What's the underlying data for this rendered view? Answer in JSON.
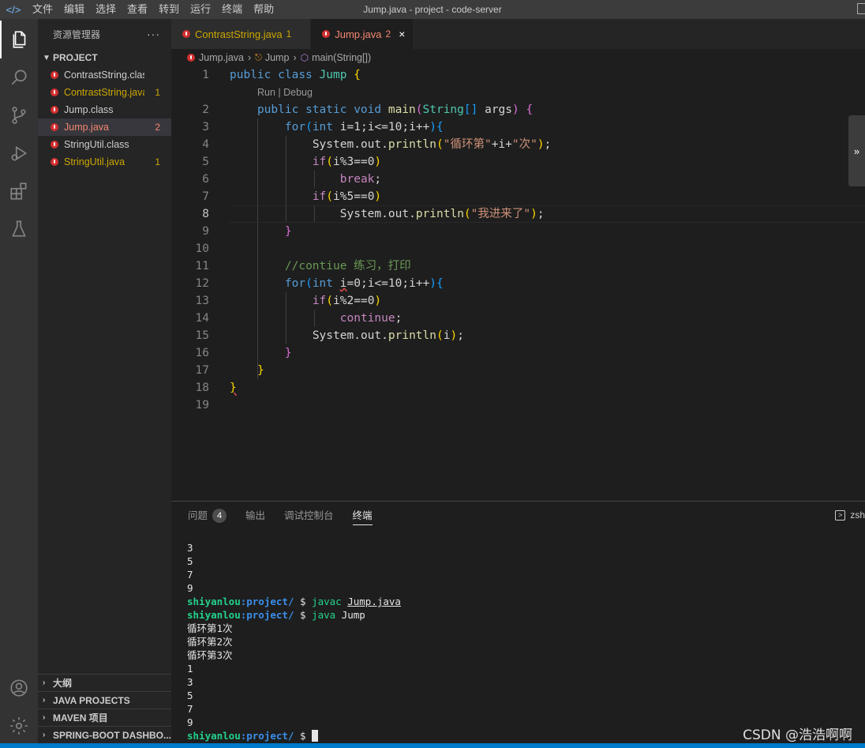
{
  "titlebar": {
    "menu": [
      "文件",
      "编辑",
      "选择",
      "查看",
      "转到",
      "运行",
      "终端",
      "帮助"
    ],
    "title": "Jump.java - project - code-server"
  },
  "activity": [
    "explorer-icon",
    "search-icon",
    "source-control-icon",
    "run-debug-icon",
    "extensions-icon",
    "testing-icon",
    "account-icon",
    "settings-gear-icon"
  ],
  "sidebar": {
    "header": "资源管理器",
    "more": "···",
    "project_title": "PROJECT",
    "files": [
      {
        "name": "ContrastString.class",
        "badge": "",
        "status": "normal"
      },
      {
        "name": "ContrastString.java",
        "badge": "1",
        "status": "warning"
      },
      {
        "name": "Jump.class",
        "badge": "",
        "status": "normal"
      },
      {
        "name": "Jump.java",
        "badge": "2",
        "status": "error"
      },
      {
        "name": "StringUtil.class",
        "badge": "",
        "status": "normal"
      },
      {
        "name": "StringUtil.java",
        "badge": "1",
        "status": "warning"
      }
    ],
    "bottom_sections": [
      "大纲",
      "JAVA PROJECTS",
      "MAVEN 项目",
      "SPRING-BOOT DASHBO..."
    ]
  },
  "tabs": [
    {
      "name": "ContrastString.java",
      "badge": "1",
      "active": false
    },
    {
      "name": "Jump.java",
      "badge": "2",
      "active": true,
      "close": "×"
    }
  ],
  "breadcrumb": [
    "Jump.java",
    "Jump",
    "main(String[])"
  ],
  "codelens": "Run | Debug",
  "code_lines": [
    "public class Jump {",
    "    public static void main(String[] args) {",
    "        for(int i=1;i<=10;i++){",
    "            System.out.println(\"循环第\"+i+\"次\");",
    "            if(i%3==0)",
    "                break;",
    "            if(i%5==0)",
    "                System.out.println(\"我进来了\");",
    "        }",
    "",
    "        //contiue 练习，打印",
    "        for(int i=0;i<=10;i++){",
    "            if(i%2==0)",
    "                continue;",
    "            System.out.println(i);",
    "        }",
    "    }",
    "}",
    ""
  ],
  "line_numbers": [
    "1",
    "2",
    "3",
    "4",
    "5",
    "6",
    "7",
    "8",
    "9",
    "10",
    "11",
    "12",
    "13",
    "14",
    "15",
    "16",
    "17",
    "18",
    "19"
  ],
  "panel": {
    "tabs": [
      "问题",
      "输出",
      "调试控制台",
      "终端"
    ],
    "problems_count": "4",
    "active_tab": "终端",
    "shell": "zsh"
  },
  "terminal": {
    "user": "shiyanlou",
    "path": ":project/",
    "prompt": " $ ",
    "pre_output": [
      "3",
      "5",
      "7",
      "9"
    ],
    "cmd1_name": "javac",
    "cmd1_arg": "Jump.java",
    "cmd2_name": "java",
    "cmd2_arg": "Jump",
    "output": [
      "循环第1次",
      "循环第2次",
      "循环第3次",
      "1",
      "3",
      "5",
      "7",
      "9"
    ]
  },
  "watermark": "CSDN @浩浩啊啊",
  "colors": {
    "accent": "#007acc",
    "error": "#f48771",
    "warning": "#cca700"
  }
}
